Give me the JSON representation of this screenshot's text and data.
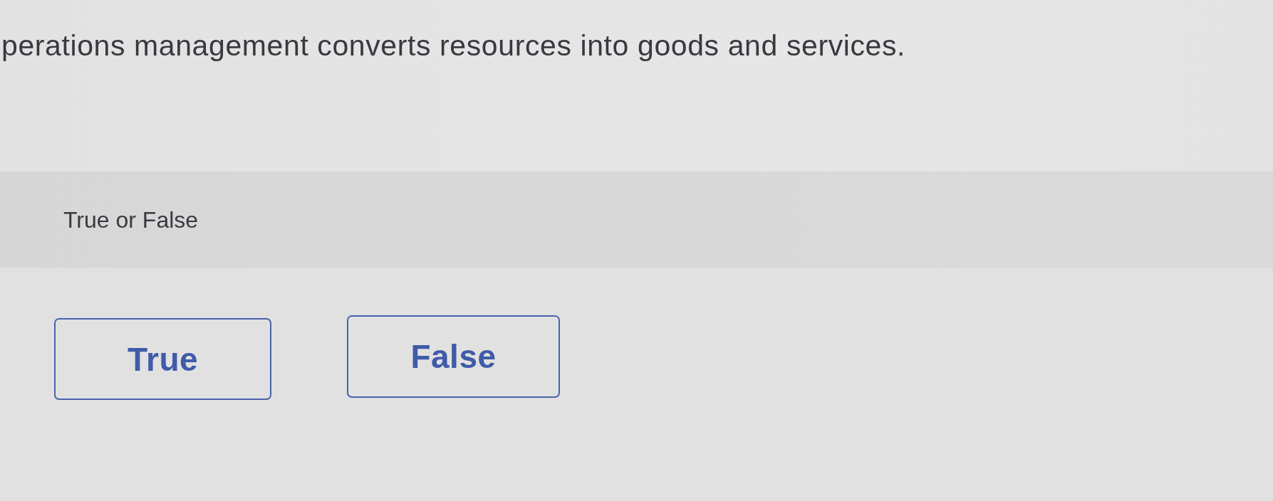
{
  "question": {
    "statement": "perations management converts resources into goods and services.",
    "prompt": "True or False"
  },
  "choices": [
    {
      "label": "True",
      "selected": false
    },
    {
      "label": "False",
      "selected": false
    }
  ]
}
